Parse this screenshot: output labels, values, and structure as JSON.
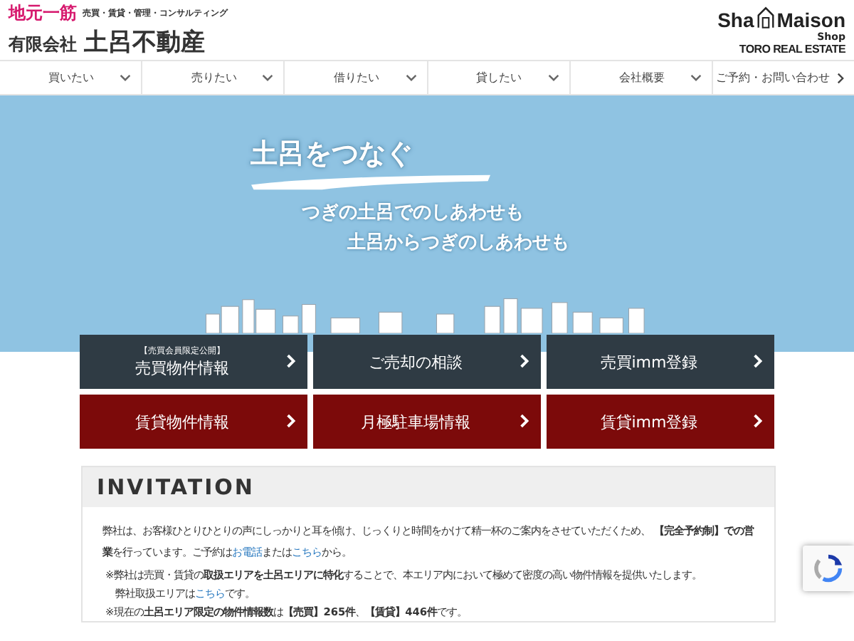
{
  "header": {
    "tagline": "地元一筋",
    "services": "売買・賃貸・管理・コンサルティング",
    "company_type": "有限会社",
    "company_name": "土呂不動産",
    "partner_logo": {
      "part1": "Sha",
      "part2": "Maison",
      "shop": "Shop",
      "office": "TORO REAL ESTATE"
    }
  },
  "nav": [
    {
      "label": "買いたい",
      "kind": "dropdown"
    },
    {
      "label": "売りたい",
      "kind": "dropdown"
    },
    {
      "label": "借りたい",
      "kind": "dropdown"
    },
    {
      "label": "貸したい",
      "kind": "dropdown"
    },
    {
      "label": "会社概要",
      "kind": "dropdown"
    },
    {
      "label": "ご予約・お問い合わせ",
      "kind": "link"
    }
  ],
  "hero": {
    "title": "土呂をつなぐ",
    "lines": [
      "つぎの土呂でのしあわせも",
      "土呂からつぎのしあわせも"
    ]
  },
  "buttons": [
    {
      "sublabel": "【売買会員限定公開】",
      "label": "売買物件情報",
      "kind": "sale"
    },
    {
      "label": "ご売却の相談",
      "kind": "sale"
    },
    {
      "label": "売買imm登録",
      "kind": "sale"
    },
    {
      "label": "賃貸物件情報",
      "kind": "rent"
    },
    {
      "label": "月極駐車場情報",
      "kind": "rent"
    },
    {
      "label": "賃貸imm登録",
      "kind": "rent"
    }
  ],
  "invitation": {
    "title": "INVITATION",
    "paragraphs": [
      [
        {
          "kind": "text",
          "text": "弊社は、お客様ひとりひとりの声にしっかりと耳を傾け、じっくりと時間をかけて精一杯のご案内をさせていただくため、 **【完全予約制】での営業**を行っています。ご予約は"
        },
        {
          "kind": "link",
          "text": "お電話"
        },
        {
          "kind": "text",
          "text": "または"
        },
        {
          "kind": "link",
          "text": "こちら"
        },
        {
          "kind": "text",
          "text": "から。"
        }
      ],
      [
        {
          "kind": "text",
          "text": "※弊社は売買・賃貸の**取扱エリアを土呂エリアに特化**することで、本エリア内において極めて密度の高い物件情報を提供いたします。"
        }
      ],
      [
        {
          "kind": "text",
          "text": "弊社取扱エリアは"
        },
        {
          "kind": "link",
          "text": "こちら"
        },
        {
          "kind": "text",
          "text": "です。"
        }
      ],
      [
        {
          "kind": "text",
          "text": "※現在の**土呂エリア限定の物件情報数**は**【売買】265件**、**【賃貸】446件**です。"
        }
      ]
    ]
  }
}
